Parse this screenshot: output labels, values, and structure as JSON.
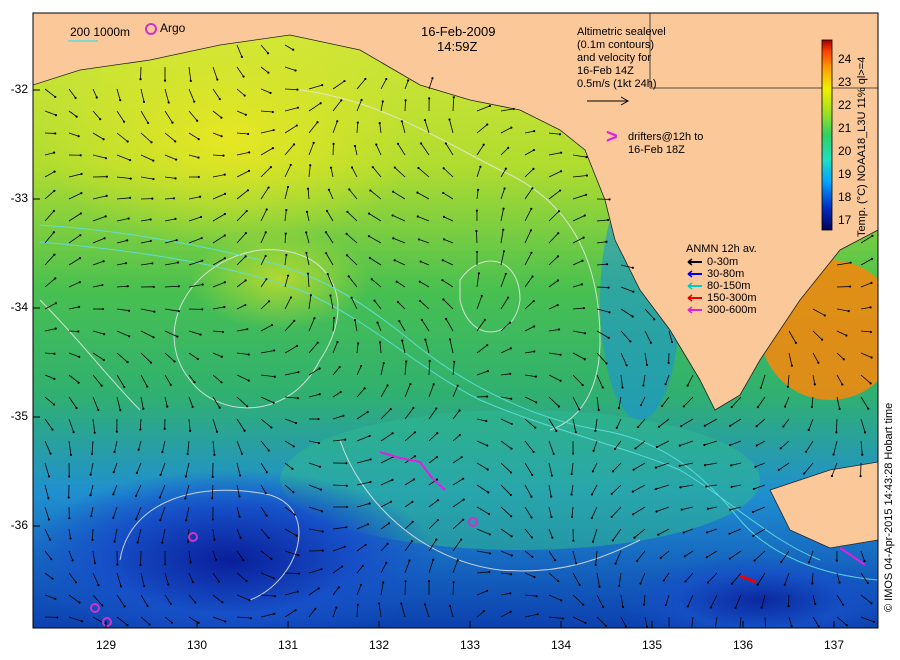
{
  "header": {
    "date": "16-Feb-2009",
    "time": "14:59Z"
  },
  "scale_legend": {
    "label": "200  1000m",
    "argo_label": "Argo",
    "argo_color": "#cc33cc",
    "contour_color": "#55dddd"
  },
  "altimetry_note": [
    "Altimetric sealevel",
    "(0.1m contours)",
    "and velocity for",
    "16-Feb 14Z",
    "0.5m/s (1kt 24h)"
  ],
  "drifters_note": {
    "symbol": ">",
    "lines": [
      "drifters@12h to",
      "16-Feb 18Z"
    ],
    "color": "#e020e0"
  },
  "anmn_legend": {
    "title": "ANMN 12h av.",
    "items": [
      {
        "label": "0-30m",
        "color": "#000000"
      },
      {
        "label": "30-80m",
        "color": "#0000ee"
      },
      {
        "label": "80-150m",
        "color": "#00cccc"
      },
      {
        "label": "150-300m",
        "color": "#ee0000"
      },
      {
        "label": "300-600m",
        "color": "#e020e0"
      }
    ]
  },
  "colorbar": {
    "title": "Temp. (°C) NOAA18_L3U 11% ql>=4",
    "ticks": [
      "24",
      "23",
      "22",
      "21",
      "20",
      "19",
      "18",
      "17"
    ],
    "range": [
      16.5,
      24.8
    ],
    "colors": [
      "#00005a",
      "#0030c0",
      "#00a0ff",
      "#20e0c0",
      "#30d060",
      "#a0e020",
      "#f0f000",
      "#ffa000",
      "#ff4000",
      "#a00000"
    ]
  },
  "axes": {
    "lat_ticks": [
      "-32",
      "-33",
      "-34",
      "-35",
      "-36"
    ],
    "lon_ticks": [
      "129",
      "130",
      "131",
      "132",
      "133",
      "134",
      "135",
      "136",
      "137"
    ]
  },
  "map": {
    "land_color": "#fbc89a",
    "ocean_warm": "#b8e040",
    "ocean_mid": "#40c060",
    "ocean_cool": "#1080e0",
    "ocean_cold": "#0a20a0"
  },
  "credit": "© IMOS 04-Apr-2015 14:43:28 Hobart time"
}
